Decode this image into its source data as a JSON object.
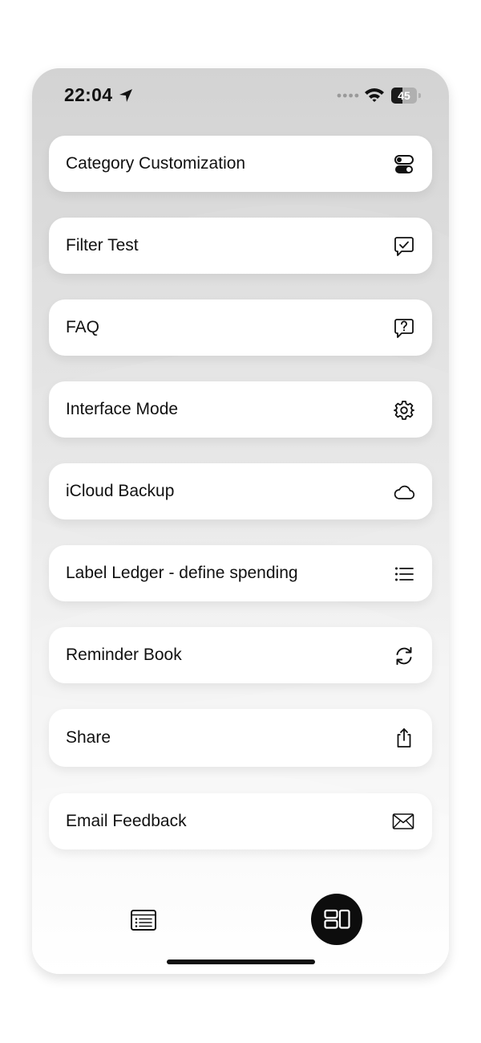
{
  "status_bar": {
    "time": "22:04",
    "battery_percent": 45,
    "battery_label": "45",
    "icons": [
      "location-arrow-icon",
      "signal-dots-icon",
      "wifi-icon",
      "battery-icon"
    ]
  },
  "menu": {
    "items": [
      {
        "label": "Category Customization",
        "icon": "toggle-switches-icon"
      },
      {
        "label": "Filter Test",
        "icon": "chat-checkmark-icon"
      },
      {
        "label": "FAQ",
        "icon": "chat-question-icon"
      },
      {
        "label": "Interface Mode",
        "icon": "gear-icon"
      },
      {
        "label": "iCloud Backup",
        "icon": "cloud-icon"
      },
      {
        "label": "Label Ledger - define spending",
        "icon": "bulleted-list-icon"
      },
      {
        "label": "Reminder Book",
        "icon": "refresh-arrows-icon"
      },
      {
        "label": "Share",
        "icon": "share-icon"
      },
      {
        "label": "Email Feedback",
        "icon": "envelope-icon"
      }
    ]
  },
  "tab_bar": {
    "tabs": [
      {
        "icon": "list-document-icon",
        "selected": false
      },
      {
        "icon": "dashboard-layout-icon",
        "selected": true
      }
    ],
    "selected_color": "#0d0d0d"
  },
  "colors": {
    "background_top": "#d3d3d3",
    "background_bottom": "#ffffff",
    "card": "#ffffff",
    "text": "#111111"
  }
}
